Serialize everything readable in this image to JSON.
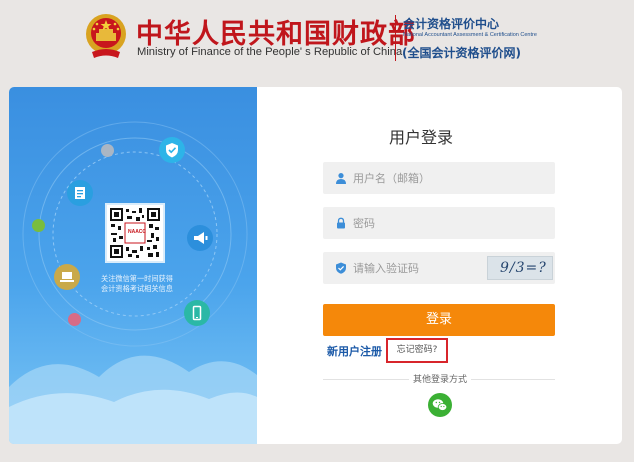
{
  "header": {
    "ministry_cn": "中华人民共和国财政部",
    "ministry_en": "Ministry of Finance of the People' s Republic of China",
    "center_cn": "会计资格评价中心",
    "center_en": "National Accountant Assessment & Certification Centre",
    "center_site": "(全国会计资格评价网)"
  },
  "promo": {
    "qr_label": "NAACC",
    "text_line1": "关注微信第一时间获得",
    "text_line2": "会计资格考试相关信息"
  },
  "login": {
    "title": "用户登录",
    "username_placeholder": "用户名（邮箱）",
    "password_placeholder": "密码",
    "captcha_placeholder": "请输入验证码",
    "captcha_text": "9/3=?",
    "submit_label": "登录",
    "register_label": "新用户注册",
    "forgot_label": "忘记密码?",
    "other_methods_label": "其他登录方式"
  },
  "colors": {
    "brand_red": "#c0161c",
    "brand_blue": "#1f4e8c",
    "accent_orange": "#f5880a",
    "wechat_green": "#3bb034"
  }
}
